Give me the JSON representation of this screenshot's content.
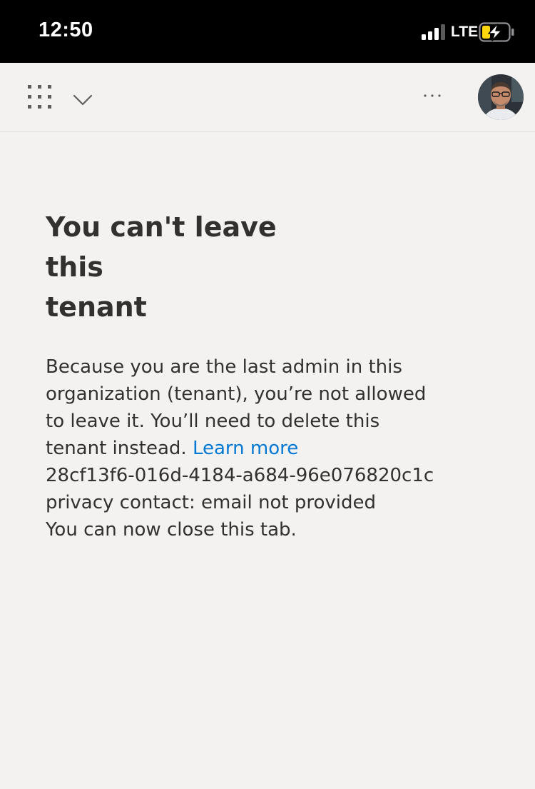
{
  "status_bar": {
    "time": "12:50",
    "network": "LTE",
    "signal_bars": 3,
    "signal_bars_total": 4,
    "battery_charging": true,
    "battery_color": "#ffd60a"
  },
  "header": {
    "background": "#f3f2f1",
    "icons": {
      "launcher": "app-launcher-waffle-icon",
      "switcher": "chevron-down-icon",
      "more": "more-options-ellipsis-icon",
      "avatar": "user-avatar"
    }
  },
  "main": {
    "title_line1": "You can't leave this",
    "title_line2": "tenant",
    "body_line1": "Because you are the last admin in this",
    "body_line2": "organization (tenant), you’re not allowed",
    "body_line3": "to leave it. You’ll need to delete this",
    "body_line4_prefix": "tenant instead. ",
    "learn_more": "Learn more",
    "tenant_id": "28cf13f6-016d-4184-a684-96e076820c1c",
    "privacy_contact": "privacy contact: email not provided",
    "close_tab_note": "You can now close this tab.",
    "link_color": "#0078d4"
  }
}
